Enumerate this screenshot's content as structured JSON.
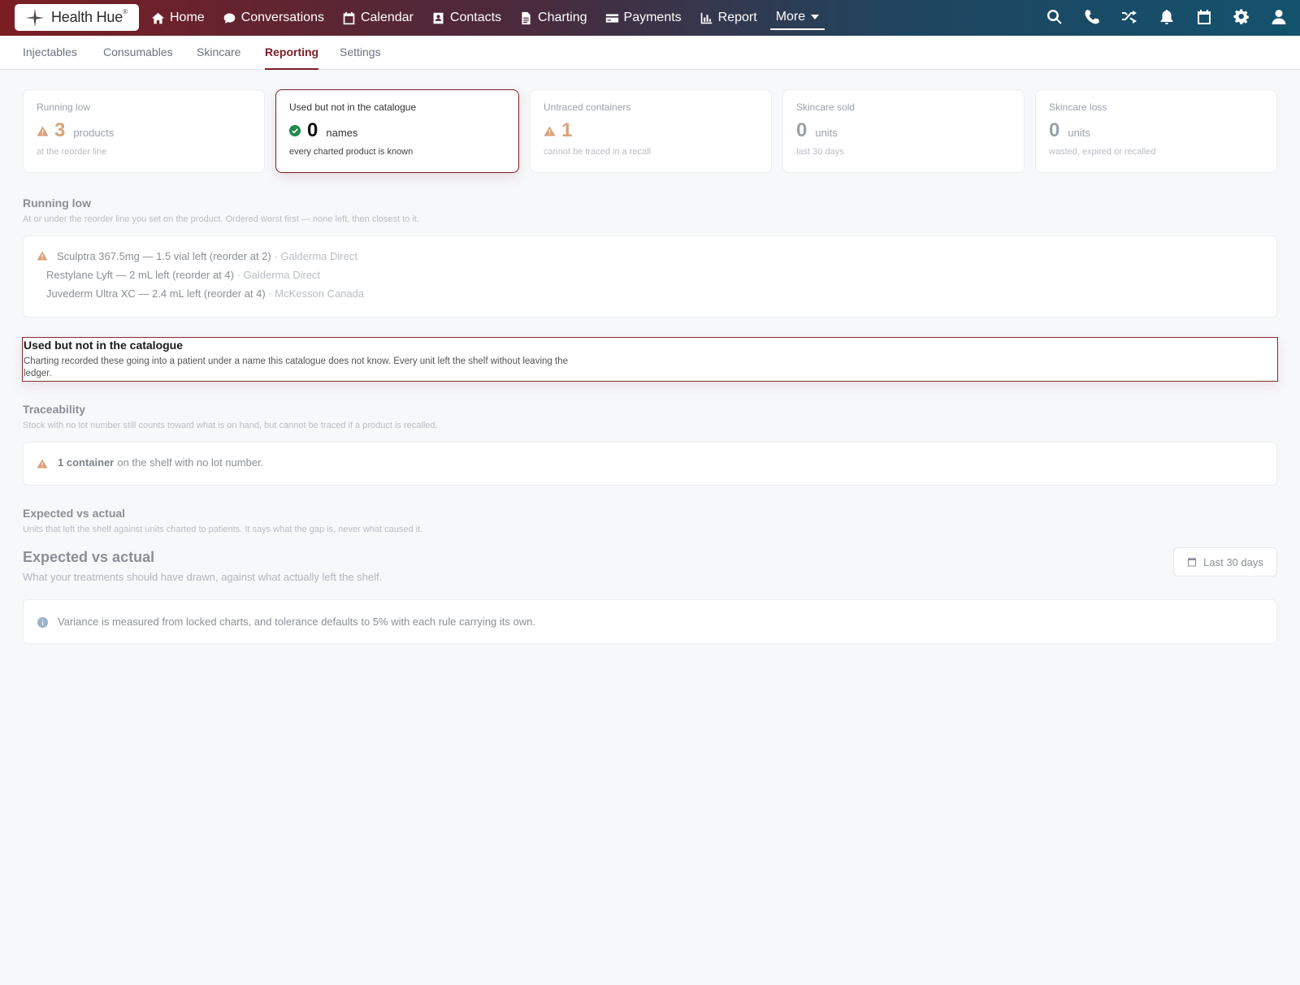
{
  "brand": {
    "name": "Health Hue",
    "mark": "®"
  },
  "nav": {
    "items": [
      {
        "label": "Home",
        "icon": "home-icon"
      },
      {
        "label": "Conversations",
        "icon": "chat-icon"
      },
      {
        "label": "Calendar",
        "icon": "calendar-icon"
      },
      {
        "label": "Contacts",
        "icon": "contact-card-icon"
      },
      {
        "label": "Charting",
        "icon": "document-icon"
      },
      {
        "label": "Payments",
        "icon": "credit-card-icon"
      },
      {
        "label": "Report",
        "icon": "bar-chart-icon"
      }
    ],
    "more_label": "More",
    "right_icons": [
      "search-icon",
      "phone-icon",
      "shuffle-icon",
      "bell-icon",
      "calendar-icon",
      "gear-icon",
      "user-icon"
    ]
  },
  "tabs": [
    {
      "label": "Injectables",
      "active": false
    },
    {
      "label": "Consumables",
      "active": false
    },
    {
      "label": "Skincare",
      "active": false
    },
    {
      "label": "Reporting",
      "active": true
    },
    {
      "label": "Settings",
      "active": false
    }
  ],
  "cards": [
    {
      "label": "Running low",
      "value": "3",
      "unit": "products",
      "sub": "at the reorder line",
      "status": "warning"
    },
    {
      "label": "Used but not in the catalogue",
      "value": "0",
      "unit": "names",
      "sub": "every charted product is known",
      "status": "ok",
      "selected": true
    },
    {
      "label": "Untraced containers",
      "value": "1",
      "unit": "",
      "sub": "cannot be traced in a recall",
      "status": "warning"
    },
    {
      "label": "Skincare sold",
      "value": "0",
      "unit": "units",
      "sub": "last 30 days",
      "status": "neutral"
    },
    {
      "label": "Skincare loss",
      "value": "0",
      "unit": "units",
      "sub": "wasted, expired or recalled",
      "status": "neutral"
    }
  ],
  "running_low": {
    "title": "Running low",
    "desc": "At or under the reorder line you set on the product. Ordered worst first — none left, then closest to it.",
    "items": [
      {
        "text": "Sculptra 367.5mg — 1.5 vial left (reorder at 2)",
        "vendor": "· Galderma Direct",
        "warn": true
      },
      {
        "text": "Restylane Lyft — 2 mL left (reorder at 4)",
        "vendor": "· Galderma Direct",
        "warn": false
      },
      {
        "text": "Juvederm Ultra XC — 2.4 mL left (reorder at 4)",
        "vendor": "· McKesson Canada",
        "warn": false
      }
    ]
  },
  "uncatalogued": {
    "title": "Used but not in the catalogue",
    "desc": "Charting recorded these going into a patient under a name this catalogue does not know. Every unit left the shelf without leaving the ledger."
  },
  "traceability": {
    "title": "Traceability",
    "desc": "Stock with no lot number still counts toward what is on hand, but cannot be traced if a product is recalled.",
    "count_label": "1 container",
    "rest": "on the shelf with no lot number."
  },
  "expected": {
    "title": "Expected vs actual",
    "desc": "Units that left the shelf against units charted to patients. It says what the gap is, never what caused it.",
    "big_title": "Expected vs actual",
    "big_desc": "What your treatments should have drawn, against what actually left the shelf.",
    "range_label": "Last 30 days",
    "info": "Variance is measured from locked charts, and tolerance defaults to 5% with each rule carrying its own."
  },
  "colors": {
    "accent": "#7b1e24",
    "warning": "#d8a27a",
    "ok": "#1f8a4c",
    "info": "#9cb3c9"
  }
}
